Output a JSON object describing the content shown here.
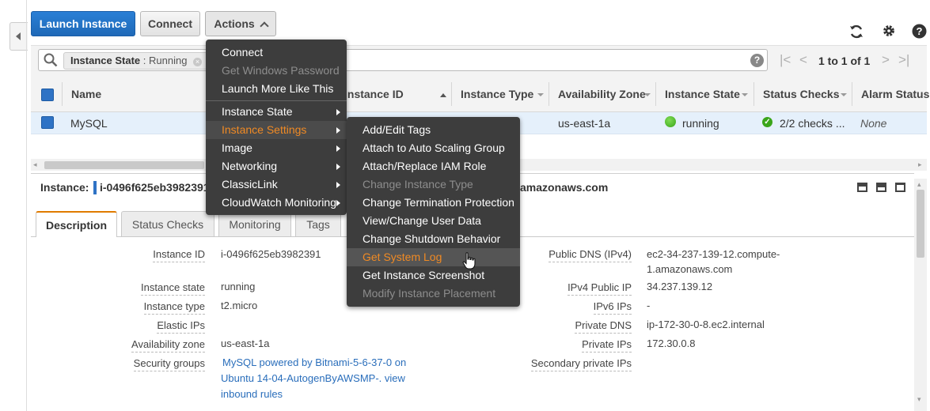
{
  "toolbar": {
    "launch_label": "Launch Instance",
    "connect_label": "Connect",
    "actions_label": "Actions"
  },
  "search": {
    "token_key": "Instance State",
    "token_sep": " : ",
    "token_value": "Running",
    "help": "?"
  },
  "pagination": {
    "text": "1 to 1 of 1"
  },
  "table": {
    "headers": {
      "name": "Name",
      "instance_id": "Instance ID",
      "instance_type": "Instance Type",
      "az": "Availability Zone",
      "state": "Instance State",
      "status": "Status Checks",
      "alarm": "Alarm Status"
    },
    "row": {
      "name": "MySQL",
      "az": "us-east-1a",
      "state": "running",
      "status": "2/2 checks ...",
      "alarm": "None"
    }
  },
  "detail": {
    "instance_label": "Instance:",
    "instance_id": "i-0496f625eb3982391",
    "dns_tail": "amazonaws.com",
    "tabs": [
      "Description",
      "Status Checks",
      "Monitoring",
      "Tags"
    ],
    "left": [
      {
        "label": "Instance ID",
        "value": "i-0496f625eb3982391"
      },
      {
        "label": "Instance state",
        "value": "running"
      },
      {
        "label": "Instance type",
        "value": "t2.micro"
      },
      {
        "label": "Elastic IPs",
        "value": ""
      },
      {
        "label": "Availability zone",
        "value": "us-east-1a"
      },
      {
        "label": "Security groups",
        "value_line1": "MySQL powered by Bitnami-5-6-37-0 on",
        "value_line2": "Ubuntu 14-04-AutogenByAWSMP-.",
        "value_link": "view",
        "value_line3": "inbound rules"
      }
    ],
    "right": [
      {
        "label": "Public DNS (IPv4)",
        "value_line1": "ec2-34-237-139-12.compute-",
        "value_line2": "1.amazonaws.com"
      },
      {
        "label": "IPv4 Public IP",
        "value": "34.237.139.12"
      },
      {
        "label": "IPv6 IPs",
        "value": "-"
      },
      {
        "label": "Private DNS",
        "value": "ip-172-30-0-8.ec2.internal"
      },
      {
        "label": "Private IPs",
        "value": "172.30.0.8"
      },
      {
        "label": "Secondary private IPs",
        "value": ""
      }
    ]
  },
  "actions_menu": {
    "items": [
      {
        "label": "Connect",
        "disabled": false
      },
      {
        "label": "Get Windows Password",
        "disabled": true
      },
      {
        "label": "Launch More Like This",
        "disabled": false
      },
      {
        "label": "Instance State",
        "submenu": true
      },
      {
        "label": "Instance Settings",
        "submenu": true,
        "active": true
      },
      {
        "label": "Image",
        "submenu": true
      },
      {
        "label": "Networking",
        "submenu": true
      },
      {
        "label": "ClassicLink",
        "submenu": true
      },
      {
        "label": "CloudWatch Monitoring",
        "submenu": true
      }
    ]
  },
  "settings_menu": {
    "items": [
      {
        "label": "Add/Edit Tags",
        "disabled": false
      },
      {
        "label": "Attach to Auto Scaling Group",
        "disabled": false
      },
      {
        "label": "Attach/Replace IAM Role",
        "disabled": false
      },
      {
        "label": "Change Instance Type",
        "disabled": true
      },
      {
        "label": "Change Termination Protection",
        "disabled": false
      },
      {
        "label": "View/Change User Data",
        "disabled": false
      },
      {
        "label": "Change Shutdown Behavior",
        "disabled": false
      },
      {
        "label": "Get System Log",
        "hover": true
      },
      {
        "label": "Get Instance Screenshot",
        "disabled": false
      },
      {
        "label": "Modify Instance Placement",
        "disabled": true
      }
    ]
  },
  "colors": {
    "primary": "#2a7fd6",
    "menu_bg": "#3d3d3d",
    "menu_accent": "#f08a24",
    "running": "#3aa51a",
    "selected_row": "#e5f0fb"
  }
}
